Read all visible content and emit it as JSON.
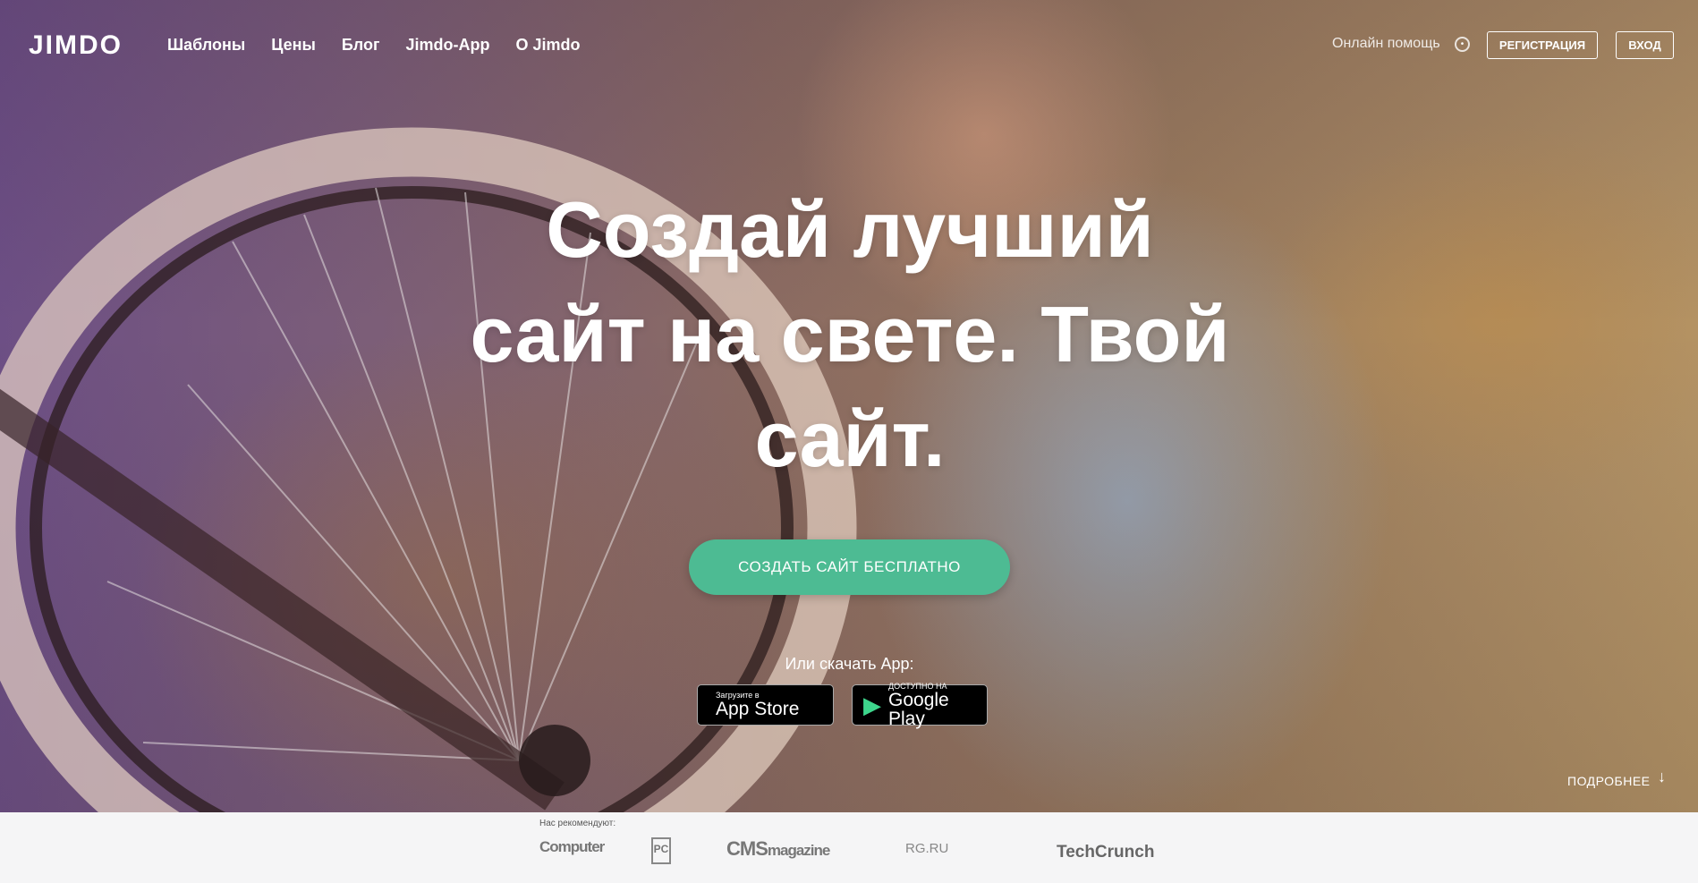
{
  "header": {
    "logo": "JIMDO",
    "nav": [
      "Шаблоны",
      "Цены",
      "Блог",
      "Jimdo-App",
      "О Jimdo"
    ],
    "help": "Онлайн помощь",
    "register": "РЕГИСТРАЦИЯ",
    "login": "ВХОД"
  },
  "hero": {
    "line1": "Создай лучший",
    "line2": "сайт на свете. Твой",
    "line3": "сайт.",
    "cta": "СОЗДАТЬ САЙТ БЕСПЛАТНО",
    "app_label": "Или скачать App:",
    "appstore_small": "Загрузите в",
    "appstore_big": "App Store",
    "gplay_small": "ДОСТУПНО НА",
    "gplay_big": "Google Play",
    "more": "ПОДРОБНЕЕ"
  },
  "press": {
    "label": "Нас рекомендуют:",
    "logos": [
      "Computer",
      "PC",
      "CMS",
      "magazine",
      "RG.RU",
      "TechCrunch"
    ]
  },
  "colors": {
    "cta": "#4dbb93"
  },
  "icons": [
    "globe-icon",
    "apple-icon",
    "google-play-icon",
    "arrow-down-icon"
  ]
}
